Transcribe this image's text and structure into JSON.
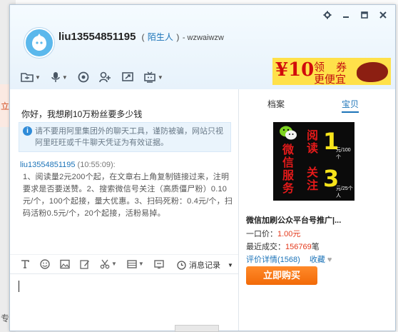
{
  "background": {
    "left_text_1": "立即",
    "left_text_2": "专"
  },
  "window": {
    "controls": [
      "gear-icon",
      "minimize-icon",
      "maximize-icon",
      "close-icon"
    ]
  },
  "contact": {
    "username": "liu13554851195",
    "paren_open": "(",
    "relationship": "陌生人",
    "paren_close": ")",
    "shop_suffix": "- wzwaiwzw"
  },
  "toolbar": {
    "icons": [
      "folder-icon",
      "microphone-icon",
      "camera-icon",
      "add-contact-icon",
      "screen-share-icon",
      "remote-assist-icon"
    ]
  },
  "ad": {
    "price": "¥10",
    "line1": "领 券",
    "line2": "更便宜"
  },
  "chat": {
    "greeting": "你好，我想刷10万粉丝要多少钱",
    "notice": "请不要用阿里集团外的聊天工具，谨防被骗，网站只视阿里旺旺或千牛聊天凭证为有效证据。",
    "message": {
      "sender": "liu13554851195",
      "time": " (10:55:09):",
      "body": "1、阅读量2元200个起，在文章右上角复制链接过来，注明要求是否要送赞。2、搜索微信号关注（高质僵尸粉）0.10元/个，100个起接，量大优惠。3、扫码死粉：0.4元/个，扫码活粉0.5元/个，20个起接，活粉易掉。"
    }
  },
  "editor": {
    "icons": [
      "text-format-icon",
      "emoji-icon",
      "image-icon",
      "edit-icon",
      "scissors-icon",
      "table-icon",
      "shake-icon"
    ],
    "history_label": "消息记录"
  },
  "sidebar": {
    "tabs": [
      "档案",
      "宝贝"
    ],
    "product": {
      "image_text_col1": "微信服务",
      "image_text_col2a": "阅读",
      "image_text_col2b": "关注",
      "num1": "1",
      "num2": "3",
      "unit1": "元/100个",
      "unit2": "元/25个人",
      "title": "微信加刷公众平台号推广|...",
      "price_label": "一口价：",
      "price": "1.00元",
      "recent_label": "最近成交：",
      "recent_value": "156769",
      "recent_unit": "笔",
      "rating": "评价详情(1568)",
      "favorite": "收藏",
      "buy_button": "立即购买"
    }
  },
  "colors": {
    "accent_blue": "#1b73b8",
    "buy_orange": "#f26a08",
    "price_red": "#e4391b"
  }
}
